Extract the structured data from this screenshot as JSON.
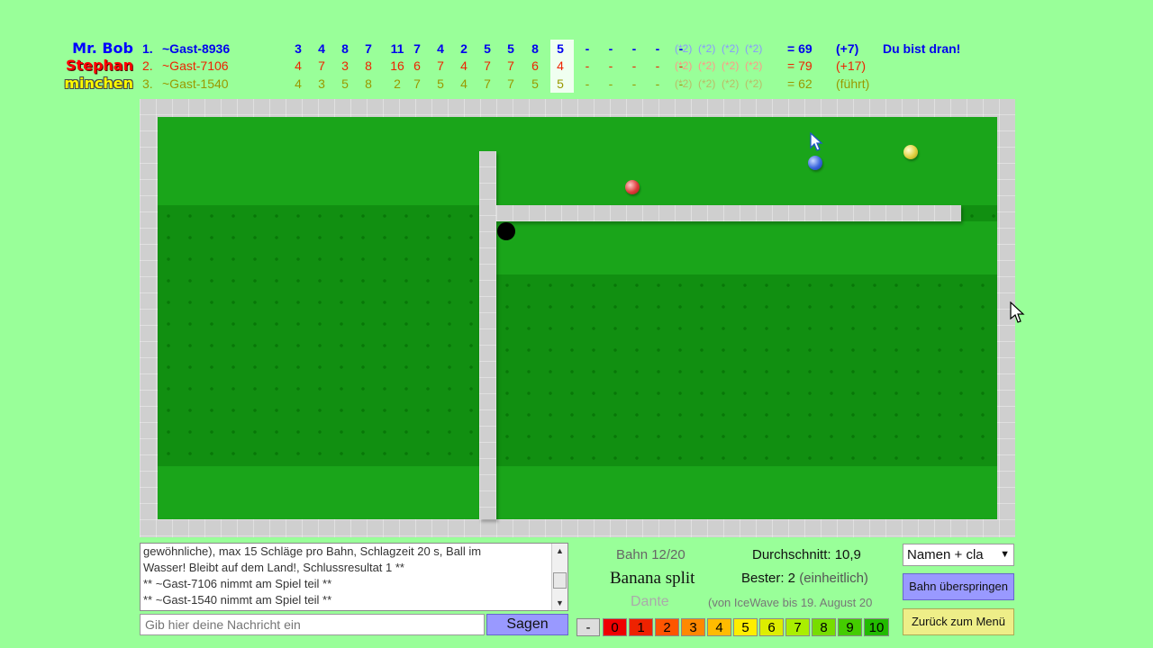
{
  "players": [
    {
      "nick": "Mr. Bob",
      "rank": "1.",
      "name": "~Gast-8936",
      "scores": [
        "3",
        "4",
        "8",
        "7",
        "11",
        "7",
        "4",
        "2",
        "5",
        "5",
        "8",
        "5",
        "-",
        "-",
        "-",
        "-",
        "-"
      ],
      "pars": [
        "(*2)",
        "(*2)",
        "(*2)",
        "(*2)"
      ],
      "total": "= 69",
      "diff": "(+7)",
      "status": "Du bist dran!"
    },
    {
      "nick": "Stephan",
      "rank": "2.",
      "name": "~Gast-7106",
      "scores": [
        "4",
        "7",
        "3",
        "8",
        "16",
        "6",
        "7",
        "4",
        "7",
        "7",
        "6",
        "4",
        "-",
        "-",
        "-",
        "-",
        "-"
      ],
      "pars": [
        "(*2)",
        "(*2)",
        "(*2)",
        "(*2)"
      ],
      "total": "= 79",
      "diff": "(+17)",
      "status": ""
    },
    {
      "nick": "minchen",
      "rank": "3.",
      "name": "~Gast-1540",
      "scores": [
        "4",
        "3",
        "5",
        "8",
        "2",
        "7",
        "5",
        "4",
        "7",
        "7",
        "5",
        "5",
        "-",
        "-",
        "-",
        "-",
        "-"
      ],
      "pars": [
        "(*2)",
        "(*2)",
        "(*2)",
        "(*2)"
      ],
      "total": "= 62",
      "diff": "(führt)",
      "status": ""
    }
  ],
  "colors": {
    "player1": "#0000ee",
    "player2": "#ee2200",
    "player3": "#999900",
    "background": "#99ff99",
    "green": "#1aa51a"
  },
  "chat": {
    "lines": [
      " gewöhnliche), max 15 Schläge pro Bahn, Schlagzeit 20 s, Ball im",
      " Wasser! Bleibt auf dem Land!, Schlussresultat 1 **",
      "** ~Gast-7106 nimmt am Spiel teil **",
      "** ~Gast-1540 nimmt am Spiel teil **"
    ],
    "placeholder": "Gib hier deine Nachricht ein",
    "send_label": "Sagen"
  },
  "track": {
    "number": "Bahn 12/20",
    "name": "Banana split",
    "author": "Dante",
    "credit": "(von IceWave bis 19. August 20",
    "average": "Durchschnitt: 10,9",
    "best": "Bester: 2",
    "best_note": "(einheitlich)"
  },
  "rating": {
    "minus": "-",
    "values": [
      "0",
      "1",
      "2",
      "3",
      "4",
      "5",
      "6",
      "7",
      "8",
      "9",
      "10"
    ]
  },
  "controls": {
    "select_value": "Namen + cla",
    "skip_label": "Bahn überspringen",
    "menu_label": "Zurück zum Menü"
  }
}
